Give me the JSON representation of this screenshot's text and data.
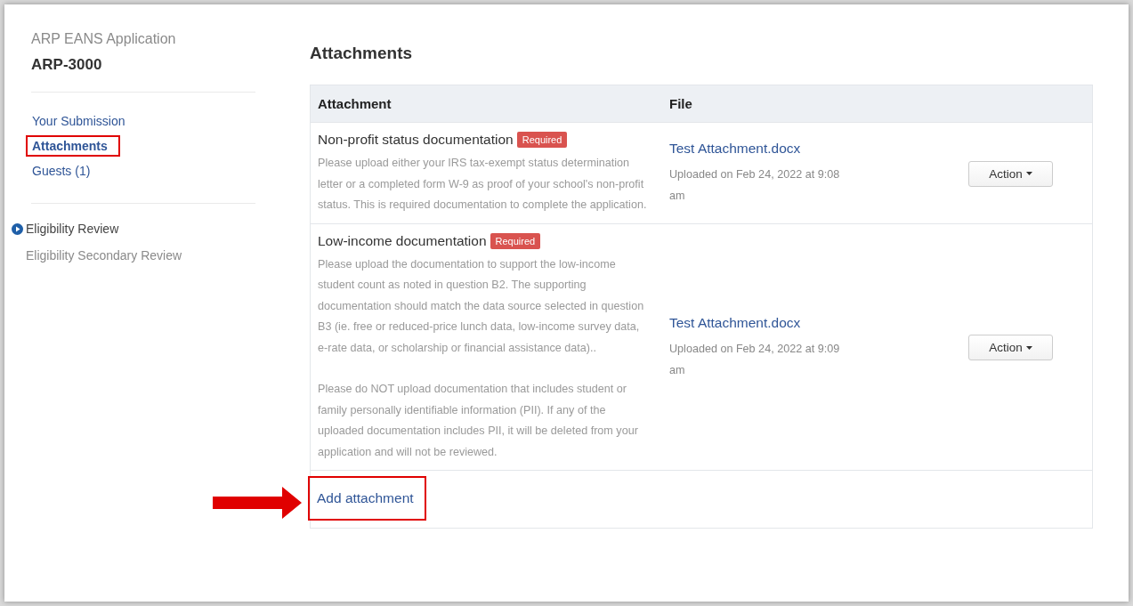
{
  "sidebar": {
    "subtitle": "ARP EANS Application",
    "title": "ARP-3000",
    "nav": [
      {
        "label": "Your Submission",
        "selected": false,
        "highlighted": false
      },
      {
        "label": "Attachments",
        "selected": true,
        "highlighted": true
      },
      {
        "label": "Guests (1)",
        "selected": false,
        "highlighted": false
      }
    ],
    "steps": [
      {
        "label": "Eligibility Review",
        "current": true
      },
      {
        "label": "Eligibility Secondary Review",
        "current": false
      }
    ]
  },
  "main": {
    "heading": "Attachments",
    "table": {
      "columns": [
        "Attachment",
        "File"
      ],
      "rows": [
        {
          "name": "Non-profit status documentation",
          "badge": "Required",
          "paragraphs": [
            "Please upload either your IRS tax-exempt status determination letter or a completed form W-9 as proof of your school's non-profit status. This is required documentation to complete the application."
          ],
          "file": "Test Attachment.docx",
          "uploaded": "Uploaded on Feb 24, 2022 at 9:08 am",
          "action": "Action"
        },
        {
          "name": "Low-income documentation",
          "badge": "Required",
          "paragraphs": [
            "Please upload the documentation to support the low-income student count as noted in question B2. The supporting documentation should match the data source selected in question B3 (ie. free or reduced-price lunch data, low-income survey data, e-rate data, or scholarship or financial assistance data)..",
            "Please do NOT upload documentation that includes student or family personally identifiable information (PII). If any of the uploaded documentation includes PII, it will be deleted from your application and will not be reviewed."
          ],
          "file": "Test Attachment.docx",
          "uploaded": "Uploaded on Feb 24, 2022 at 9:09 am",
          "action": "Action"
        }
      ],
      "add_link": {
        "label": "Add attachment",
        "highlighted": true,
        "pointer_arrow": true
      }
    }
  }
}
